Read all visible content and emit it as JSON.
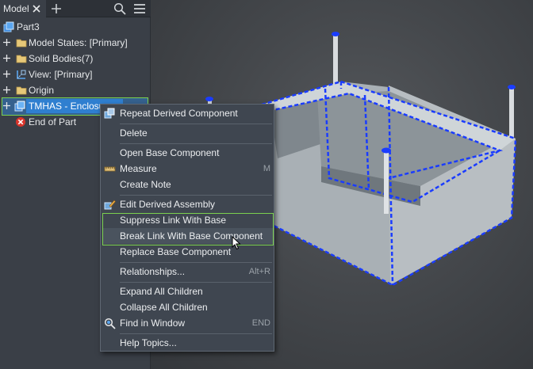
{
  "browser": {
    "tab_label": "Model",
    "tree": [
      {
        "label": "Part3",
        "icon": "part-icon"
      },
      {
        "label": "Model States: [Primary]",
        "icon": "folder-icon"
      },
      {
        "label": "Solid Bodies(7)",
        "icon": "folder-icon"
      },
      {
        "label": "View: [Primary]",
        "icon": "view-icon"
      },
      {
        "label": "Origin",
        "icon": "folder-icon"
      },
      {
        "label": "TMHAS - Enclosure",
        "icon": "derived-assembly-icon"
      },
      {
        "label": "End of Part",
        "icon": "end-of-part-icon"
      }
    ]
  },
  "context_menu": {
    "items": [
      {
        "label": "Repeat Derived Component",
        "shortcut": ""
      },
      {
        "label": "Delete",
        "shortcut": ""
      },
      {
        "label": "Open Base Component",
        "shortcut": ""
      },
      {
        "label": "Measure",
        "shortcut": "M"
      },
      {
        "label": "Create Note",
        "shortcut": ""
      },
      {
        "label": "Edit Derived Assembly",
        "shortcut": ""
      },
      {
        "label": "Suppress Link With Base Component",
        "shortcut": ""
      },
      {
        "label": "Break Link With Base Component",
        "shortcut": ""
      },
      {
        "label": "Replace Base Component",
        "shortcut": ""
      },
      {
        "label": "Relationships...",
        "shortcut": "Alt+R"
      },
      {
        "label": "Expand All Children",
        "shortcut": ""
      },
      {
        "label": "Collapse All Children",
        "shortcut": ""
      },
      {
        "label": "Find in Window",
        "shortcut": "END"
      },
      {
        "label": "Help Topics...",
        "shortcut": ""
      }
    ]
  },
  "colors": {
    "selection_blue": "#2f7fd0",
    "highlight_green": "#7bd14f",
    "edge_highlight": "#1a3cff"
  }
}
